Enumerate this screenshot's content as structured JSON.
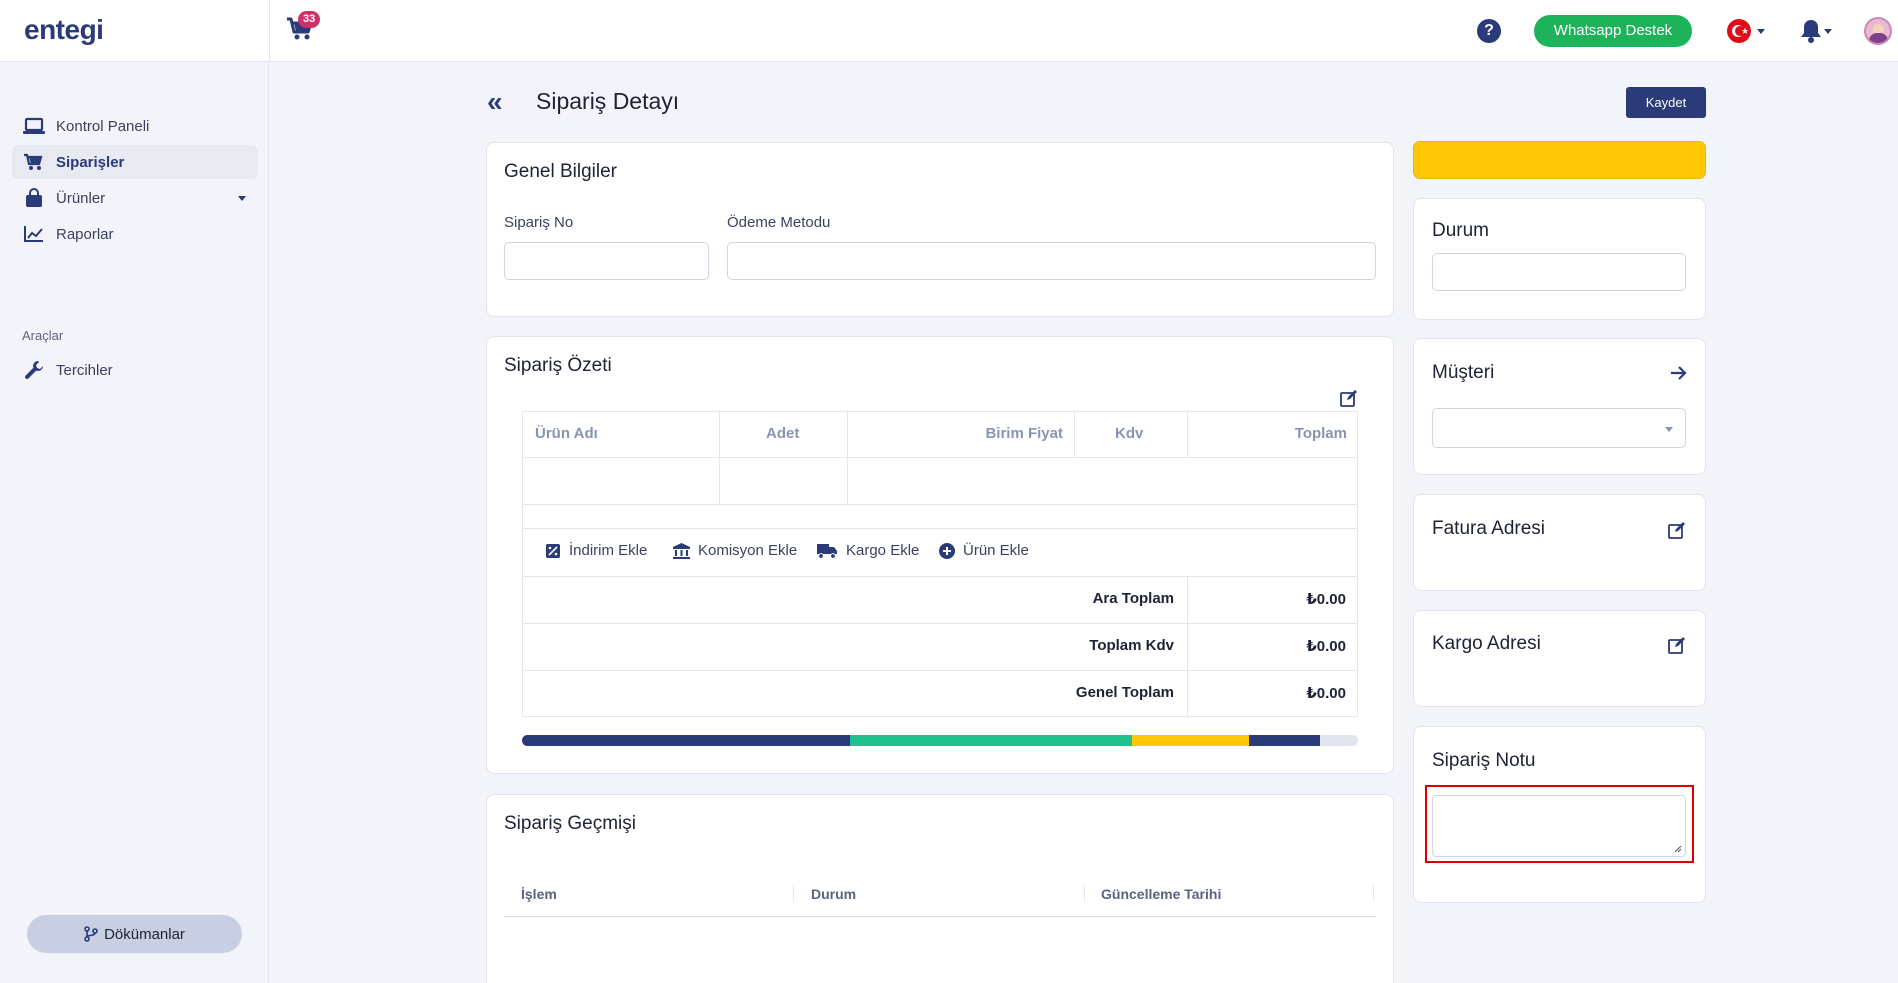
{
  "app": {
    "logo": "entegi",
    "cart_count": "33",
    "help_label": "?",
    "whatsapp_label": "Whatsapp Destek",
    "language": "TR"
  },
  "sidebar": {
    "items": [
      {
        "label": "Kontrol Paneli",
        "icon": "laptop-icon"
      },
      {
        "label": "Siparişler",
        "icon": "cart-icon",
        "active": true
      },
      {
        "label": "Ürünler",
        "icon": "bag-icon",
        "has_submenu": true
      },
      {
        "label": "Raporlar",
        "icon": "chart-line-icon"
      }
    ],
    "section_title": "Araçlar",
    "tools": [
      {
        "label": "Tercihler",
        "icon": "wrench-icon"
      }
    ],
    "docs_label": "Dökümanlar"
  },
  "page": {
    "back_icon": "«",
    "title": "Sipariş Detayı",
    "save_label": "Kaydet"
  },
  "general": {
    "title": "Genel Bilgiler",
    "order_no_label": "Sipariş No",
    "order_no_value": "",
    "payment_label": "Ödeme Metodu",
    "payment_value": ""
  },
  "summary": {
    "title": "Sipariş Özeti",
    "columns": [
      "Ürün Adı",
      "Adet",
      "Birim Fiyat",
      "Kdv",
      "Toplam"
    ],
    "actions": [
      {
        "label": "İndirim Ekle",
        "icon": "discount-icon"
      },
      {
        "label": "Komisyon Ekle",
        "icon": "bank-icon"
      },
      {
        "label": "Kargo Ekle",
        "icon": "truck-icon"
      },
      {
        "label": "Ürün Ekle",
        "icon": "plus-circle-icon"
      }
    ],
    "totals": [
      {
        "label": "Ara Toplam",
        "value": "₺0.00"
      },
      {
        "label": "Toplam Kdv",
        "value": "₺0.00"
      },
      {
        "label": "Genel Toplam",
        "value": "₺0.00"
      }
    ],
    "progress_segments": [
      {
        "fraction": 0.392,
        "color": "#2b3a78"
      },
      {
        "fraction": 0.338,
        "color": "#22c08e"
      },
      {
        "fraction": 0.14,
        "color": "#ffc807"
      },
      {
        "fraction": 0.085,
        "color": "#2b3a78"
      }
    ]
  },
  "history": {
    "title": "Sipariş Geçmişi",
    "columns": [
      "İşlem",
      "Durum",
      "Güncelleme Tarihi"
    ]
  },
  "right": {
    "status_title": "Durum",
    "status_value": "",
    "customer_title": "Müşteri",
    "customer_value": "",
    "invoice_title": "Fatura Adresi",
    "shipping_title": "Kargo Adresi",
    "note_title": "Sipariş Notu",
    "note_value": ""
  },
  "colors": {
    "primary": "#2b3a78",
    "whatsapp": "#1eb35a",
    "warning": "#ffc807",
    "badge": "#d12f6a"
  }
}
